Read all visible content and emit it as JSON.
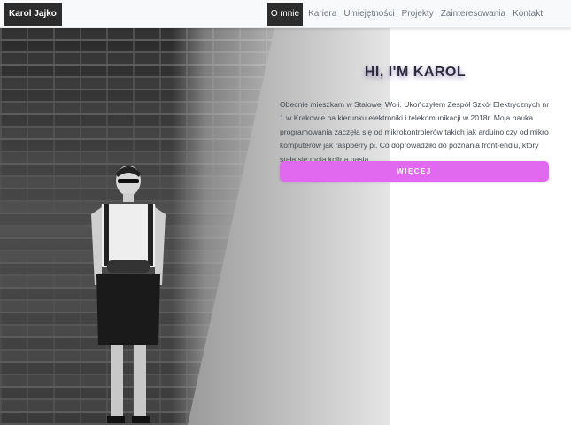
{
  "nav": {
    "brand": "Karol Jajko",
    "links": [
      {
        "label": "O mnie",
        "active": true
      },
      {
        "label": "Kariera",
        "active": false
      },
      {
        "label": "Umiejętności",
        "active": false
      },
      {
        "label": "Projekty",
        "active": false
      },
      {
        "label": "Zainteresowania",
        "active": false
      },
      {
        "label": "Kontakt",
        "active": false
      }
    ]
  },
  "hero": {
    "title": "HI, I'M KAROL",
    "description": "Obecnie mieszkam w Stalowej Woli. Ukończyłem Zespół Szkół Elektrycznych nr 1 w Krakowie na kierunku elektroniki i telekomunikacji w 2018r. Moja nauka programowania zaczęła się od mikrokontrolerów takich jak arduino czy od mikro komputerów jak raspberry pi. Co doprowadziło do poznania front-end'u, który stała się moją koljną pasją.",
    "button_label": "WIĘCEJ",
    "accent_color": "#e069f0"
  }
}
